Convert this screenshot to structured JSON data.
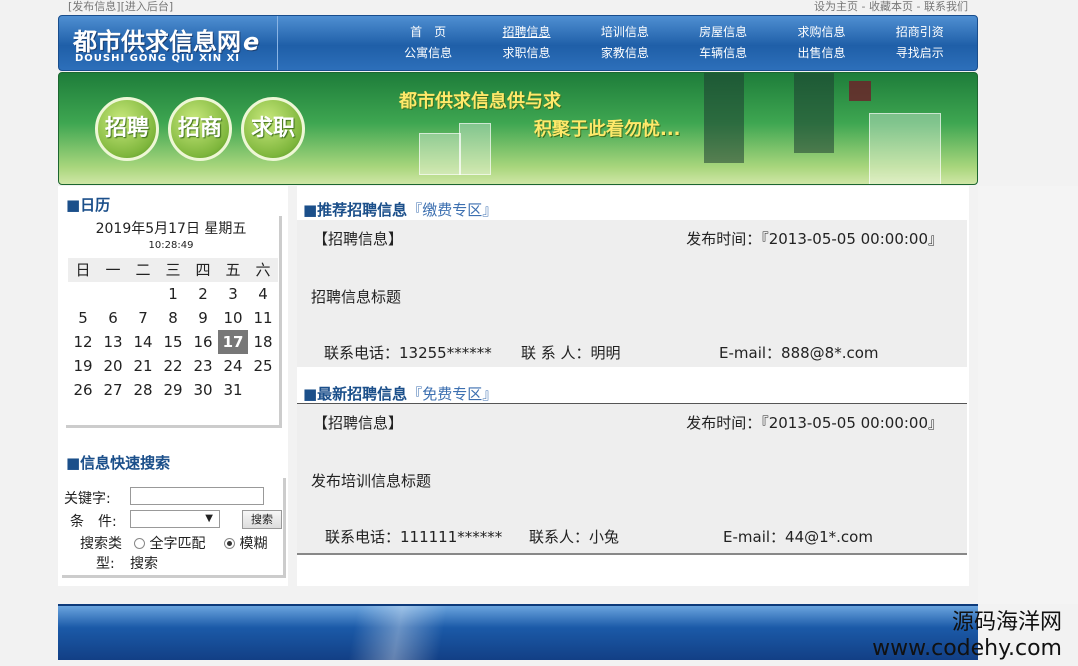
{
  "topbar": {
    "publish": "[发布信息]",
    "admin": "[进入后台]",
    "set_home": "设为主页",
    "sep1": "-",
    "bookmark": "收藏本页",
    "sep2": "-",
    "contact": "联系我们"
  },
  "logo": {
    "cn": "都市供求信息网",
    "suffix": "e",
    "en": "DOUSHI GONG QIU XIN XI"
  },
  "nav": {
    "row1": [
      "首　页",
      "招聘信息",
      "培训信息",
      "房屋信息",
      "求购信息",
      "招商引资"
    ],
    "row2": [
      "公寓信息",
      "求职信息",
      "家教信息",
      "车辆信息",
      "出售信息",
      "寻找启示"
    ]
  },
  "banner": {
    "circles": [
      "招聘",
      "招商",
      "求职"
    ],
    "slogan1": "都市供求信息供与求",
    "slogan2": "积聚于此看勿忧..."
  },
  "calendar": {
    "title": "■日历",
    "date": "2019年5月17日 星期五",
    "time": "10:28:49",
    "weekdays": [
      "日",
      "一",
      "二",
      "三",
      "四",
      "五",
      "六"
    ],
    "rows": [
      [
        "",
        "",
        "",
        "1",
        "2",
        "3",
        "4"
      ],
      [
        "5",
        "6",
        "7",
        "8",
        "9",
        "10",
        "11"
      ],
      [
        "12",
        "13",
        "14",
        "15",
        "16",
        "17",
        "18"
      ],
      [
        "19",
        "20",
        "21",
        "22",
        "23",
        "24",
        "25"
      ],
      [
        "26",
        "27",
        "28",
        "29",
        "30",
        "31",
        ""
      ]
    ],
    "today": "17"
  },
  "search": {
    "title": "■信息快速搜索",
    "keyword_label": "关键字:",
    "condition_label": "条　件:",
    "button": "搜索",
    "type_label_1": "搜索类",
    "type_label_2": "型:",
    "opt_exact": "全字匹配",
    "opt_fuzzy_1": "模糊",
    "opt_fuzzy_2": "搜索"
  },
  "sections": [
    {
      "title": "■推荐招聘信息",
      "sub": "『缴费专区』",
      "category": "【招聘信息】",
      "time": "发布时间：『2013-05-05 00:00:00』",
      "item_title": "招聘信息标题",
      "phone": "联系电话：13255******",
      "person": "联 系 人：明明",
      "email": "E-mail：888@8*.com"
    },
    {
      "title": "■最新招聘信息",
      "sub": "『免费专区』",
      "category": "【招聘信息】",
      "time": "发布时间：『2013-05-05 00:00:00』",
      "item_title": "发布培训信息标题",
      "phone": "联系电话：111111******",
      "person": "联系人：小兔",
      "email": "E-mail：44@1*.com"
    }
  ],
  "watermark": {
    "line1": "源码海洋网",
    "line2": "www.codehy.com"
  }
}
